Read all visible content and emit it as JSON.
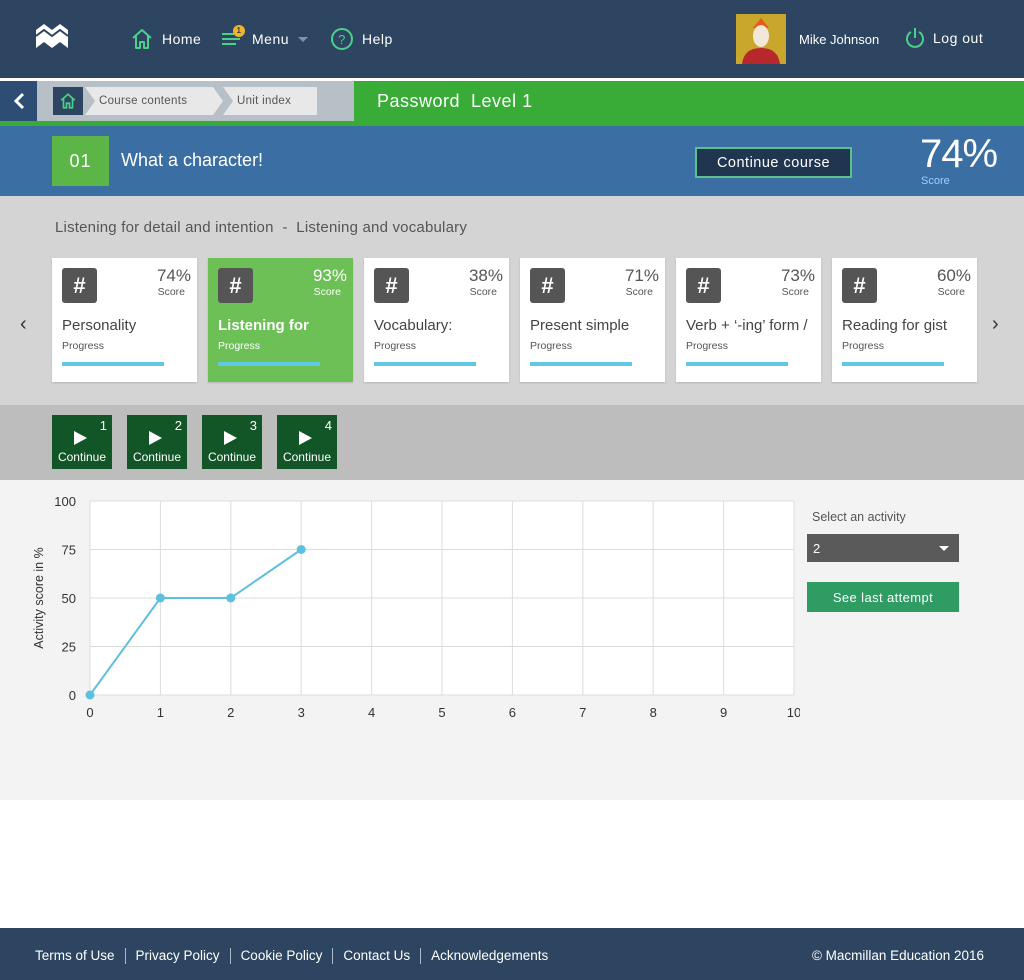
{
  "nav": {
    "home_label": "Home",
    "menu_label": "Menu",
    "menu_badge": "1",
    "help_label": "Help",
    "user_name": "Mike Johnson",
    "logout_label": "Log out"
  },
  "breadcrumb": {
    "items": [
      "Course contents",
      "Unit index"
    ],
    "course_title": "Password  Level 1"
  },
  "unit": {
    "number": "01",
    "title": "What a character!",
    "continue_label": "Continue course",
    "score": "74%",
    "score_label": "Score"
  },
  "lessons": {
    "title": "Listening for detail and intention  -  Listening and vocabulary",
    "items": [
      {
        "icon": "#",
        "score": "74%",
        "score_label": "Score",
        "name": "Personality",
        "progress_label": "Progress"
      },
      {
        "icon": "#",
        "score": "93%",
        "score_label": "Score",
        "name": "Listening for",
        "progress_label": "Progress"
      },
      {
        "icon": "#",
        "score": "38%",
        "score_label": "Score",
        "name": "Vocabulary:",
        "progress_label": "Progress"
      },
      {
        "icon": "#",
        "score": "71%",
        "score_label": "Score",
        "name": "Present simple",
        "progress_label": "Progress"
      },
      {
        "icon": "#",
        "score": "73%",
        "score_label": "Score",
        "name": "Verb + ‘-ing’ form /",
        "progress_label": "Progress"
      },
      {
        "icon": "#",
        "score": "60%",
        "score_label": "Score",
        "name": "Reading for gist",
        "progress_label": "Progress"
      }
    ],
    "prev_arrow": "‹",
    "next_arrow": "›"
  },
  "activities": [
    {
      "number": "1",
      "label": "Continue"
    },
    {
      "number": "2",
      "label": "Continue"
    },
    {
      "number": "3",
      "label": "Continue"
    },
    {
      "number": "4",
      "label": "Continue"
    }
  ],
  "chart_data": {
    "type": "line",
    "ylabel": "Activity score in %",
    "xlabel": "",
    "x": [
      0,
      1,
      2,
      3
    ],
    "values": [
      0,
      50,
      50,
      75
    ],
    "xlim": [
      0,
      10
    ],
    "ylim": [
      0,
      100
    ],
    "xticks": [
      0,
      1,
      2,
      3,
      4,
      5,
      6,
      7,
      8,
      9,
      10
    ],
    "yticks": [
      0,
      25,
      50,
      75,
      100
    ],
    "grid": true,
    "color": "#5ec0de"
  },
  "side": {
    "select_label": "Select an activity",
    "select_value": "2",
    "last_attempt_label": "See last attempt"
  },
  "footer": {
    "links": [
      "Terms of Use",
      "Privacy Policy",
      "Cookie Policy",
      "Contact Us",
      "Acknowledgements"
    ],
    "copyright": "© Macmillan Education 2016"
  },
  "colors": {
    "nav_bg": "#2d4560",
    "course_green": "#39ac37",
    "unit_blue": "#3b6fa3",
    "active_card": "#6cc055",
    "activity_green": "#125627",
    "progress_bar": "#5ec8e5"
  }
}
